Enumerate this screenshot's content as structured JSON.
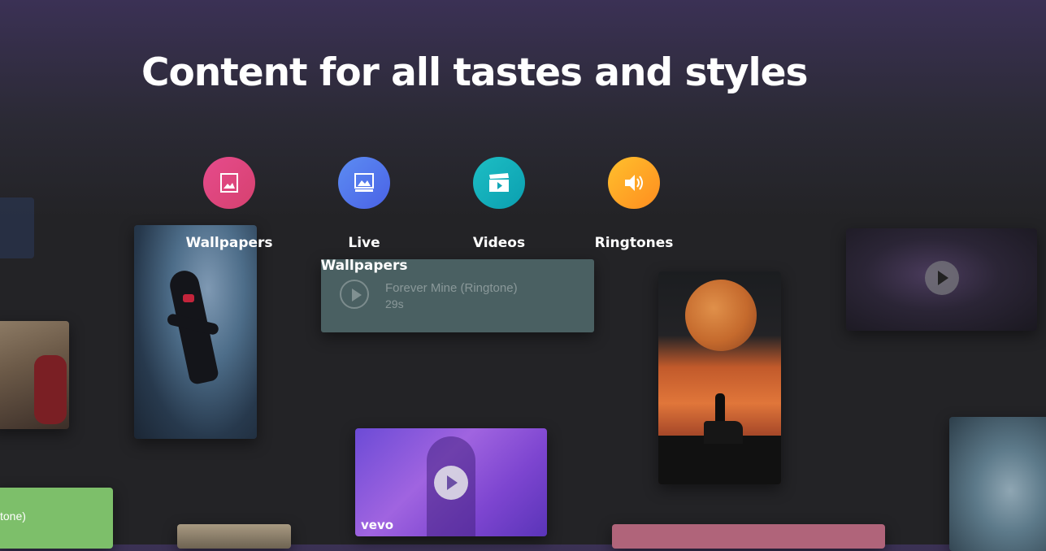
{
  "header": {
    "title": "Content for all tastes and styles"
  },
  "categories": [
    {
      "label": "Wallpapers",
      "icon": "image-icon",
      "color": "#e0487f"
    },
    {
      "label": "Live Wallpapers",
      "icon": "live-image-icon",
      "color": "#5277ec"
    },
    {
      "label": "Videos",
      "icon": "clapperboard-icon",
      "color": "#15adbb"
    },
    {
      "label": "Ringtones",
      "icon": "speaker-icon",
      "color": "#ffa626"
    }
  ],
  "ringtone_card": {
    "name": "Forever Mine (Ringtone)",
    "duration": "29s"
  },
  "video_card": {
    "brand": "vevo"
  },
  "partial_ringtone_card": {
    "text": "tone)"
  }
}
